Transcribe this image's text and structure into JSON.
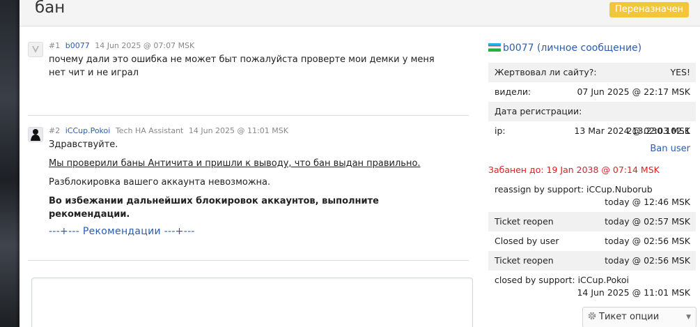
{
  "header": {
    "title": "бан",
    "status": "Переназначен"
  },
  "posts": [
    {
      "number": "#1",
      "author": "b0077",
      "role": "",
      "time": "14 Jun 2025 @ 07:07 MSK",
      "lines": [
        "почему дали это ошибка не может быт пожалуйста проверте мои демки у меня нет чит и не играл"
      ]
    },
    {
      "number": "#2",
      "author": "iCCup.Pokoi",
      "role": "Tech HA Assistant",
      "time": "14 Jun 2025 @ 11:01 MSK",
      "lines": [
        "Здравствуйте.",
        "Мы проверили баны Античита и пришли к выводу, что бан выдан правильно.",
        "Разблокировка вашего аккаунта невозможна.",
        "Во избежании дальнейших блокировок аккаунтов, выполните рекомендации.",
        "---+--- Рекомендации ---+---"
      ]
    }
  ],
  "sidebar": {
    "username": "b0077",
    "pm_label": "(личное сообщение)",
    "info": [
      {
        "key": "Жертвовал ли сайту?:",
        "value": "YES!"
      },
      {
        "key": "видели:",
        "value": "07 Jun 2025 @ 22:17 MSK"
      },
      {
        "key": "Дата регистрации:",
        "value": "13 Mar 2024 @ 02:03 MSK"
      },
      {
        "key": "ip:",
        "value": "213.230.102.1"
      }
    ],
    "ban_user": "Ban user",
    "banned_until": "Забанен до: 19 Jan 2038 @ 07:14 MSK",
    "log": [
      {
        "action": "reassign by support: iCCup.Nuborub",
        "time": "today @ 12:46 MSK"
      },
      {
        "action": "Ticket reopen",
        "time": "today @ 02:57 MSK"
      },
      {
        "action": "Closed by user",
        "time": "today @ 02:56 MSK"
      },
      {
        "action": "Ticket reopen",
        "time": "today @ 02:56 MSK"
      },
      {
        "action": "closed by support: iCCup.Pokoi",
        "time": "14 Jun 2025 @ 11:01 MSK"
      }
    ],
    "ticket_options": "Тикет опции"
  },
  "icons": {
    "post1_avatar": "default-avatar-icon",
    "post2_avatar": "silhouette-avatar-icon",
    "flag": "uzbekistan-flag-icon",
    "gear": "gear-icon",
    "caret": "chevron-down-icon"
  },
  "colors": {
    "link": "#2a5db0",
    "badge": "#f3c53a",
    "banned": "#e02020"
  }
}
